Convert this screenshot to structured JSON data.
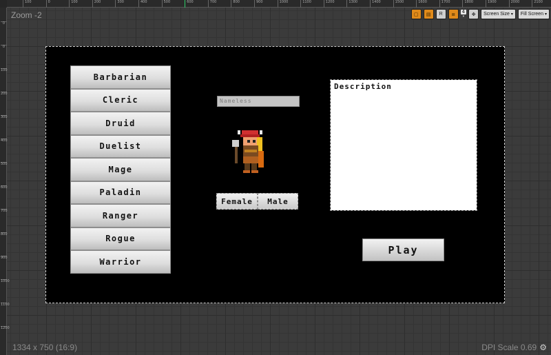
{
  "editor": {
    "zoom_label": "Zoom -2",
    "resolution_label": "1334 x 750 (16:9)",
    "dpi_label": "DPI Scale 0.69",
    "ruler_top": [
      "100",
      "0",
      "100",
      "200",
      "300",
      "400",
      "500",
      "600",
      "700",
      "800",
      "900",
      "1000",
      "1100",
      "1200",
      "1300",
      "1400",
      "1500",
      "1600",
      "1700",
      "1800",
      "1900",
      "2000",
      "2100"
    ],
    "ruler_left": [
      "0",
      "0",
      "100",
      "200",
      "300",
      "400",
      "500",
      "600",
      "700",
      "800",
      "900",
      "1000",
      "1100",
      "1200"
    ],
    "toolbar": {
      "r_label": "R",
      "grid_value": "4",
      "screen_size_label": "Screen Size",
      "fill_screen_label": "Fill Screen"
    }
  },
  "game": {
    "classes": [
      "Barbarian",
      "Cleric",
      "Druid",
      "Duelist",
      "Mage",
      "Paladin",
      "Ranger",
      "Rogue",
      "Warrior"
    ],
    "name_placeholder": "Nameless",
    "gender": {
      "female": "Female",
      "male": "Male"
    },
    "description_label": "Description",
    "play_label": "Play"
  }
}
